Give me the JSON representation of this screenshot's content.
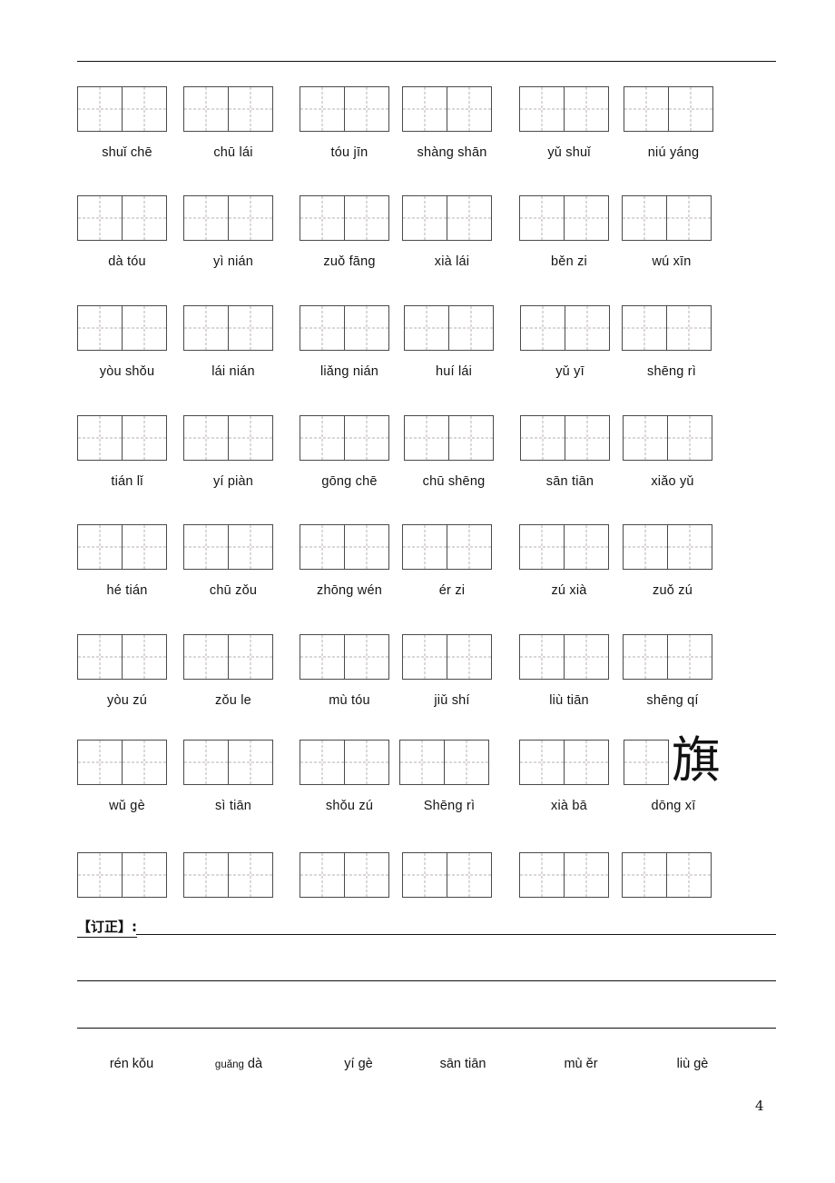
{
  "page": {
    "number": "4",
    "correction_label": "【订正】:"
  },
  "grid": {
    "rows": [
      {
        "items": [
          {
            "pinyin": "shuǐ chē",
            "boxes": 2
          },
          {
            "pinyin": "chū  lái",
            "boxes": 2
          },
          {
            "pinyin": "tóu  jīn",
            "boxes": 2
          },
          {
            "pinyin": "shàng shān",
            "boxes": 2
          },
          {
            "pinyin": "yǔ shuǐ",
            "boxes": 2
          },
          {
            "pinyin": "niú  yáng",
            "boxes": 2
          }
        ]
      },
      {
        "items": [
          {
            "pinyin": "dà  tóu",
            "boxes": 2
          },
          {
            "pinyin": "yì nián",
            "boxes": 2
          },
          {
            "pinyin": "zuǒ fāng",
            "boxes": 2
          },
          {
            "pinyin": "xià  lái",
            "boxes": 2
          },
          {
            "pinyin": "běn  zi",
            "boxes": 2
          },
          {
            "pinyin": "wú xīn",
            "boxes": 2
          }
        ]
      },
      {
        "items": [
          {
            "pinyin": "yòu  shǒu",
            "boxes": 2
          },
          {
            "pinyin": "lái nián",
            "boxes": 2
          },
          {
            "pinyin": "liǎng  nián",
            "boxes": 2
          },
          {
            "pinyin": "huí  lái",
            "boxes": 2
          },
          {
            "pinyin": "yǔ  yī",
            "boxes": 2
          },
          {
            "pinyin": "shēng  rì",
            "boxes": 2
          }
        ]
      },
      {
        "items": [
          {
            "pinyin": "tián  lǐ",
            "boxes": 2
          },
          {
            "pinyin": "yí piàn",
            "boxes": 2
          },
          {
            "pinyin": "gōng chē",
            "boxes": 2
          },
          {
            "pinyin": "chū shēng",
            "boxes": 2
          },
          {
            "pinyin": "sān  tiān",
            "boxes": 2
          },
          {
            "pinyin": "xiǎo  yǔ",
            "boxes": 2
          }
        ]
      },
      {
        "items": [
          {
            "pinyin": "hé  tián",
            "boxes": 2
          },
          {
            "pinyin": "chū  zǒu",
            "boxes": 2
          },
          {
            "pinyin": "zhōng  wén",
            "boxes": 2
          },
          {
            "pinyin": "ér  zi",
            "boxes": 2
          },
          {
            "pinyin": "zú  xià",
            "boxes": 2
          },
          {
            "pinyin": "zuǒ  zú",
            "boxes": 2
          }
        ]
      },
      {
        "items": [
          {
            "pinyin": "yòu  zú",
            "boxes": 2
          },
          {
            "pinyin": "zǒu  le",
            "boxes": 2
          },
          {
            "pinyin": "mù  tóu",
            "boxes": 2
          },
          {
            "pinyin": "jiǔ  shí",
            "boxes": 2
          },
          {
            "pinyin": "liù  tiān",
            "boxes": 2
          },
          {
            "pinyin": "shēng qí",
            "boxes": 2
          }
        ]
      },
      {
        "items": [
          {
            "pinyin": "wǔ  gè",
            "boxes": 2
          },
          {
            "pinyin": "sì  tiān",
            "boxes": 2
          },
          {
            "pinyin": "shǒu  zú",
            "boxes": 2
          },
          {
            "pinyin": "Shēng   rì",
            "boxes": 2
          },
          {
            "pinyin": "xià  bā",
            "boxes": 2
          },
          {
            "pinyin": "dōng  xī",
            "boxes": 1,
            "hanzi": "旗"
          }
        ]
      },
      {
        "items": [
          {
            "pinyin": "",
            "boxes": 2
          },
          {
            "pinyin": "",
            "boxes": 2
          },
          {
            "pinyin": "",
            "boxes": 2
          },
          {
            "pinyin": "",
            "boxes": 2
          },
          {
            "pinyin": "",
            "boxes": 2
          },
          {
            "pinyin": "",
            "boxes": 2
          }
        ]
      }
    ]
  },
  "bottom_strip": {
    "items": [
      {
        "pinyin": "rén  kǒu",
        "small_prefix": "",
        "rest": ""
      },
      {
        "pinyin": "guǎng dà",
        "small_prefix": "guǎng",
        "rest": " dà"
      },
      {
        "pinyin": "yí  gè",
        "small_prefix": "",
        "rest": ""
      },
      {
        "pinyin": "sān tiān",
        "small_prefix": "",
        "rest": ""
      },
      {
        "pinyin": "mù  ěr",
        "small_prefix": "",
        "rest": ""
      },
      {
        "pinyin": "liù  gè",
        "small_prefix": "",
        "rest": ""
      }
    ]
  }
}
